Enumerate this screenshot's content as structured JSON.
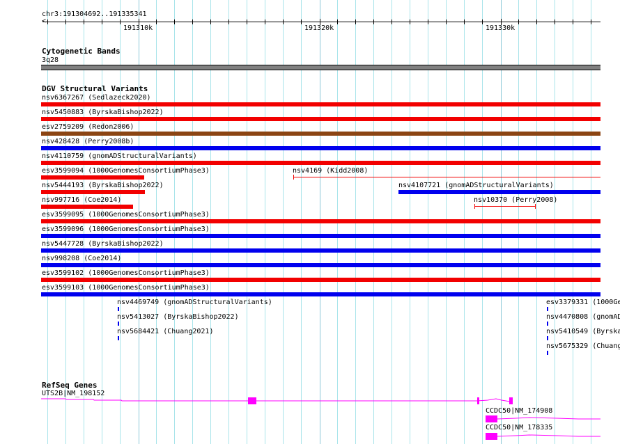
{
  "ruler": {
    "location": "chr3:191304692..191335341",
    "tick_labels": [
      "191310k",
      "191320k",
      "191330k"
    ]
  },
  "tracks": {
    "cytobands": {
      "title": "Cytogenetic Bands",
      "band": "3q28"
    },
    "dgv": {
      "title": "DGV Structural Variants",
      "features": [
        "nsv6367267 (Sedlazeck2020)",
        "nsv5450883 (ByrskaBishop2022)",
        "esv2759209 (Redon2006)",
        "nsv428428 (Perry2008b)",
        "nsv4110759 (gnomADStructuralVariants)",
        "esv3599094 (1000GenomesConsortiumPhase3)",
        "nsv4169 (Kidd2008)",
        "nsv5444193 (ByrskaBishop2022)",
        "nsv4107721 (gnomADStructuralVariants)",
        "nsv997716 (Coe2014)",
        "nsv10370 (Perry2008)",
        "esv3599095 (1000GenomesConsortiumPhase3)",
        "esv3599096 (1000GenomesConsortiumPhase3)",
        "nsv5447728 (ByrskaBishop2022)",
        "nsv998208 (Coe2014)",
        "esv3599102 (1000GenomesConsortiumPhase3)",
        "esv3599103 (1000GenomesConsortiumPhase3)",
        "nsv4469749 (gnomADStructuralVariants)",
        "nsv5413027 (ByrskaBishop2022)",
        "nsv5684421 (Chuang2021)",
        "esv3379331 (1000Ge",
        "nsv4470808 (gnomAD",
        "nsv5410549 (Byrska",
        "nsv5675329 (Chuang"
      ]
    },
    "refseq": {
      "title": "RefSeq Genes",
      "genes": [
        "UTS2B|NM_198152",
        "CCDC50|NM_174908",
        "CCDC50|NM_178335"
      ]
    }
  },
  "colors": {
    "loss": "#f20000",
    "gain": "#0000ee",
    "complex": "#8b4513",
    "gene": "#ff00ff",
    "band": "#808080"
  }
}
